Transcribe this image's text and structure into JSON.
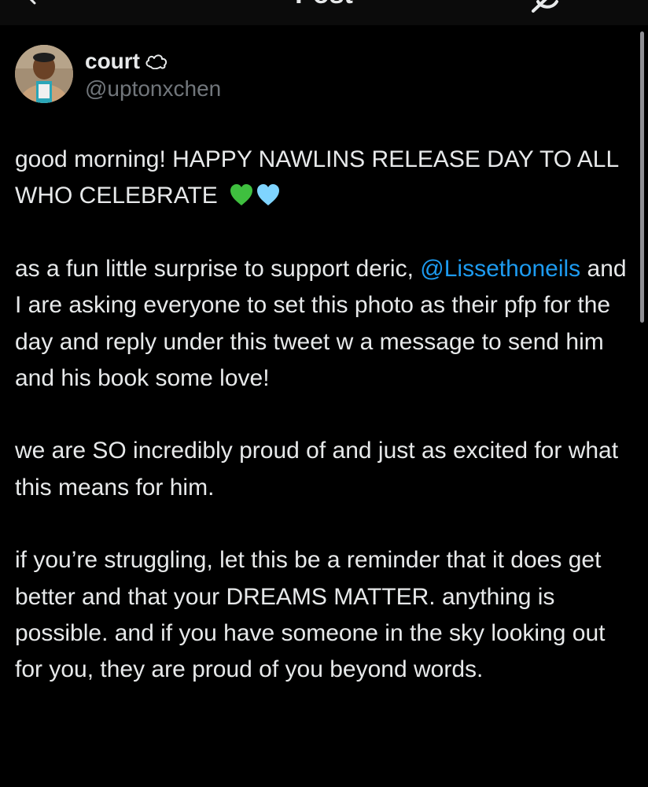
{
  "header": {
    "title": "Post",
    "back_icon": "arrow-left-icon",
    "right_icon": "grok-icon"
  },
  "author": {
    "display_name": "court",
    "name_emoji": "cloud-outline-icon",
    "handle": "@uptonxchen"
  },
  "tweet": {
    "p1_text": "good morning! HAPPY NAWLINS RELEASE DAY TO ALL WHO CELEBRATE",
    "p1_emojis": [
      "green-heart-icon",
      "light-blue-heart-icon"
    ],
    "p2_before": "as a fun little surprise to support deric,",
    "p2_mention": "@Lissethoneils",
    "p2_after": " and I are asking everyone to set this photo as their pfp for the day and reply under this tweet w a message to send him and his book some love!",
    "p3_text": "we are SO incredibly proud of and just as excited for what this means for him.",
    "p4_text": "if you’re struggling, let this be a reminder that it does get better and that your DREAMS MATTER. anything is possible. and if you have someone in the sky looking out for you, they are proud of you beyond words."
  },
  "colors": {
    "background": "#000000",
    "text": "#e7e9ea",
    "muted": "#71767b",
    "link": "#1d9bf0",
    "green_heart": "#3fbf3f",
    "blue_heart": "#7fd4ff"
  }
}
